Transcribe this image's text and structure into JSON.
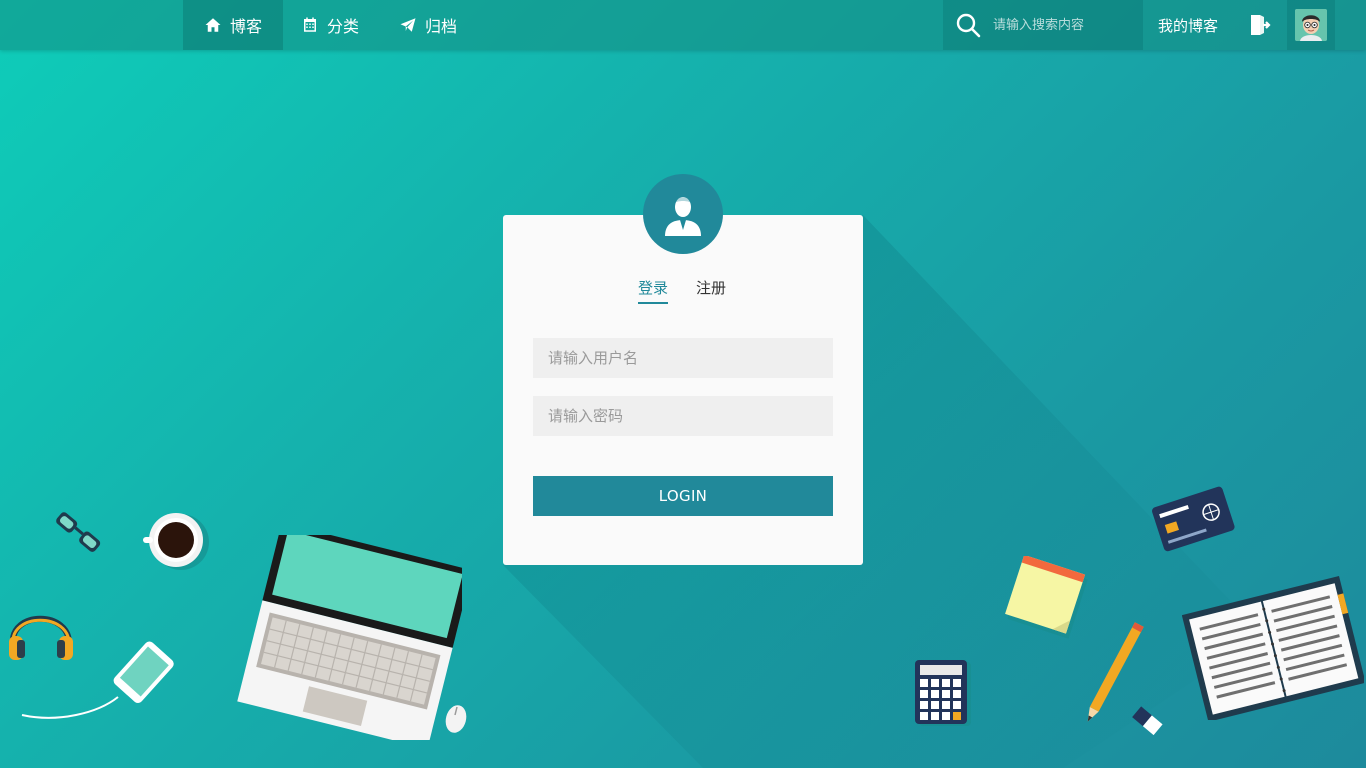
{
  "nav": {
    "items": [
      {
        "label": "博客",
        "icon": "home-icon",
        "active": true
      },
      {
        "label": "分类",
        "icon": "calendar-icon",
        "active": false
      },
      {
        "label": "归档",
        "icon": "paper-plane-icon",
        "active": false
      }
    ],
    "search": {
      "placeholder": "请输入搜索内容",
      "icon": "search-icon"
    },
    "my_blog": "我的博客",
    "logout_icon": "logout-icon",
    "avatar_icon": "user-avatar"
  },
  "login": {
    "avatar_icon": "user-icon",
    "tabs": [
      {
        "label": "登录",
        "active": true
      },
      {
        "label": "注册",
        "active": false
      }
    ],
    "username_placeholder": "请输入用户名",
    "password_placeholder": "请输入密码",
    "submit_label": "LOGIN"
  },
  "colors": {
    "accent": "#21899a",
    "background_start": "#0ecdb9",
    "background_end": "#1d8a9c",
    "card": "#fafafa"
  }
}
